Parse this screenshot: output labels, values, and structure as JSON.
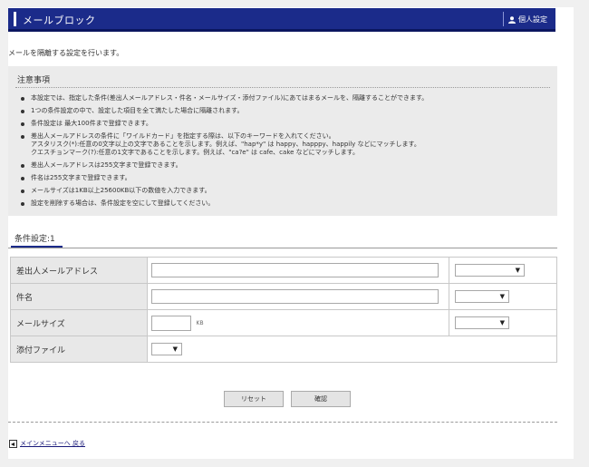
{
  "header": {
    "title": "メールブロック",
    "user_label": "個人設定",
    "user_icon": "person-icon"
  },
  "description": "メールを隔離する設定を行います。",
  "notice": {
    "title": "注意事項",
    "items": [
      "本設定では、指定した条件(差出人メールアドレス・件名・メールサイズ・添付ファイル)にあてはまるメールを、隔離することができます。",
      "1つの条件設定の中で、設定した項目を全て満たした場合に隔離されます。",
      "条件設定は 最大100件まで登録できます。",
      "差出人メールアドレスの条件に「ワイルドカード」を指定する際は、以下のキーワードを入れてください。\nアスタリスク(*):任意の0文字以上の文字であることを示します。例えば、\"hap*y\" は happy、happpy、happily などにマッチします。\nクエスチョンマーク(?):任意の1文字であることを示します。例えば、\"ca?e\" は cafe、cake などにマッチします。",
      "差出人メールアドレスは255文字まで登録できます。",
      "件名は255文字まで登録できます。",
      "メールサイズは1KB以上25600KB以下の数値を入力できます。",
      "設定を削除する場合は、条件設定を空にして登録してください。"
    ]
  },
  "tab": {
    "label": "条件設定:1"
  },
  "form": {
    "sender": {
      "label": "差出人メールアドレス",
      "value": "",
      "option": ""
    },
    "subject": {
      "label": "件名",
      "value": "",
      "option": ""
    },
    "size": {
      "label": "メールサイズ",
      "value": "",
      "unit": "KB",
      "option": ""
    },
    "attachment": {
      "label": "添付ファイル",
      "option": ""
    }
  },
  "buttons": {
    "reset": "リセット",
    "confirm": "確認"
  },
  "back_link": {
    "label": "メインメニューへ 戻る",
    "icon": "back-arrow-icon"
  },
  "colors": {
    "header_bg": "#1b2b8a",
    "notice_bg": "#ebebeb",
    "label_bg": "#e8e8e8"
  }
}
